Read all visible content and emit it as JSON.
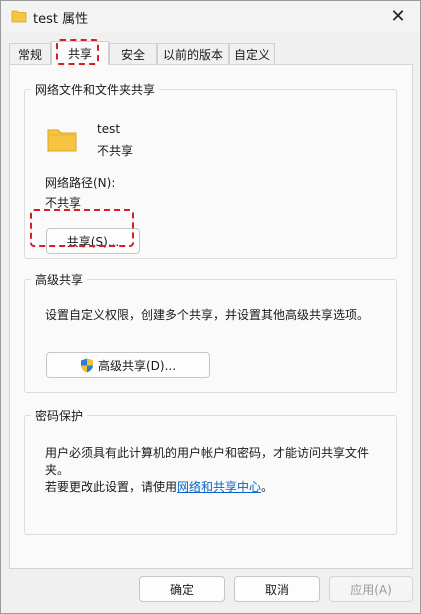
{
  "window": {
    "title": "test 属性",
    "close_glyph": "✕"
  },
  "tabs": [
    {
      "label": "常规"
    },
    {
      "label": "共享"
    },
    {
      "label": "安全"
    },
    {
      "label": "以前的版本"
    },
    {
      "label": "自定义"
    }
  ],
  "network_sharing": {
    "legend": "网络文件和文件夹共享",
    "folder_name": "test",
    "status": "不共享",
    "path_label": "网络路径(N):",
    "path_value": "不共享",
    "share_button": "共享(S)..."
  },
  "advanced_sharing": {
    "legend": "高级共享",
    "description": "设置自定义权限，创建多个共享，并设置其他高级共享选项。",
    "button": "高级共享(D)..."
  },
  "password_protection": {
    "legend": "密码保护",
    "description": "用户必须具有此计算机的用户帐户和密码，才能访问共享文件夹。",
    "change_prefix": "若要更改此设置，请使用",
    "link": "网络和共享中心",
    "change_suffix": "。"
  },
  "footer": {
    "ok": "确定",
    "cancel": "取消",
    "apply": "应用(A)"
  },
  "colors": {
    "highlight_dash": "#d81e1e",
    "link": "#0a64c8",
    "folder": "#f6c342"
  }
}
